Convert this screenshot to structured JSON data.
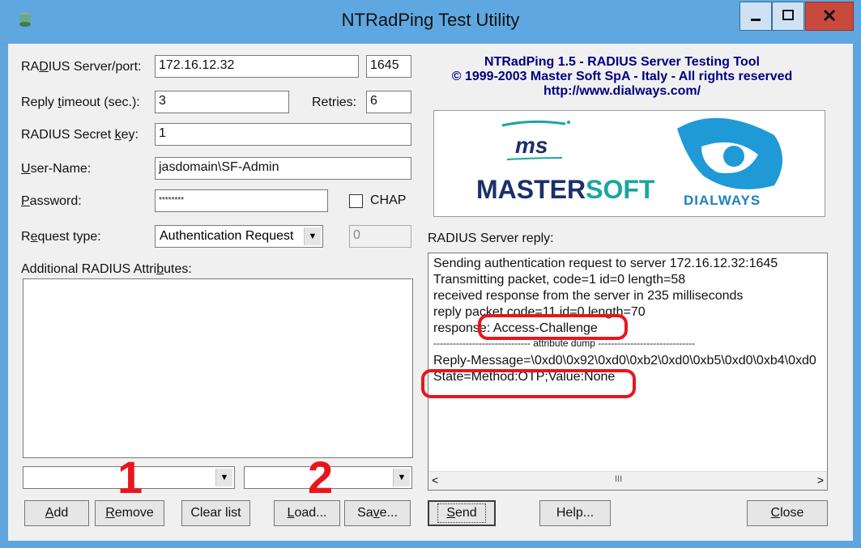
{
  "window": {
    "title": "NTRadPing Test Utility",
    "icons": {
      "app": "radius-app-icon",
      "minimize": "minimize-icon",
      "maximize": "maximize-icon",
      "close": "close-icon"
    }
  },
  "form": {
    "server_label_pre": "RA",
    "server_label_u": "D",
    "server_label_post": "IUS Server/port:",
    "server_value": "172.16.12.32",
    "port_value": "1645",
    "timeout_label_pre": "Reply ",
    "timeout_label_u": "t",
    "timeout_label_post": "imeout (sec.):",
    "timeout_value": "3",
    "retries_label": "Retries:",
    "retries_value": "6",
    "secret_label_pre": "RADIUS Secret ",
    "secret_label_u": "k",
    "secret_label_post": "ey:",
    "secret_value": "1",
    "username_label_u": "U",
    "username_label_post": "ser-Name:",
    "username_value": "jasdomain\\SF-Admin",
    "password_label_u": "P",
    "password_label_post": "assword:",
    "password_value": "********",
    "chap_label": "CHAP",
    "request_label_pre": "R",
    "request_label_u": "e",
    "request_label_post": "quest type:",
    "request_value": "Authentication Request",
    "request_id_value": "0",
    "attrs_label_pre": "Additional RADIUS Attri",
    "attrs_label_u": "b",
    "attrs_label_post": "utes:"
  },
  "buttons": {
    "add_u": "A",
    "add_post": "dd",
    "remove_u": "R",
    "remove_post": "emove",
    "clear": "Clear list",
    "load_u": "L",
    "load_post": "oad...",
    "save_pre": "Sa",
    "save_u": "v",
    "save_post": "e...",
    "send_u": "S",
    "send_post": "end",
    "help": "Help...",
    "close_u": "C",
    "close_post": "lose"
  },
  "about": {
    "line1": "NTRadPing 1.5 - RADIUS Server Testing Tool",
    "line2": "© 1999-2003 Master Soft SpA - Italy - All rights reserved",
    "line3": "http://www.dialways.com/",
    "logo_ms": "ms",
    "logo_master": "MASTER",
    "logo_soft": "SOFT",
    "logo_dialways": "DIALWAYS"
  },
  "reply": {
    "label": "RADIUS Server reply:",
    "lines": [
      "Sending authentication request to server 172.16.12.32:1645",
      "Transmitting packet, code=1 id=0 length=58",
      "received response from the server in 235 milliseconds",
      "reply packet code=11 id=0 length=70",
      "response: Access-Challenge",
      "------------------------------ attribute dump ------------------------------",
      "Reply-Message=\\0xd0\\0x92\\0xd0\\0xb2\\0xd0\\0xb5\\0xd0\\0xb4\\0xd0",
      "State=Method:OTP;Value:None"
    ],
    "scroll_mark": "III"
  },
  "annotations": {
    "one": "1",
    "two": "2"
  },
  "colors": {
    "title_bar": "#5fa7e0",
    "heading": "#000080",
    "annotation": "#e8161c"
  }
}
